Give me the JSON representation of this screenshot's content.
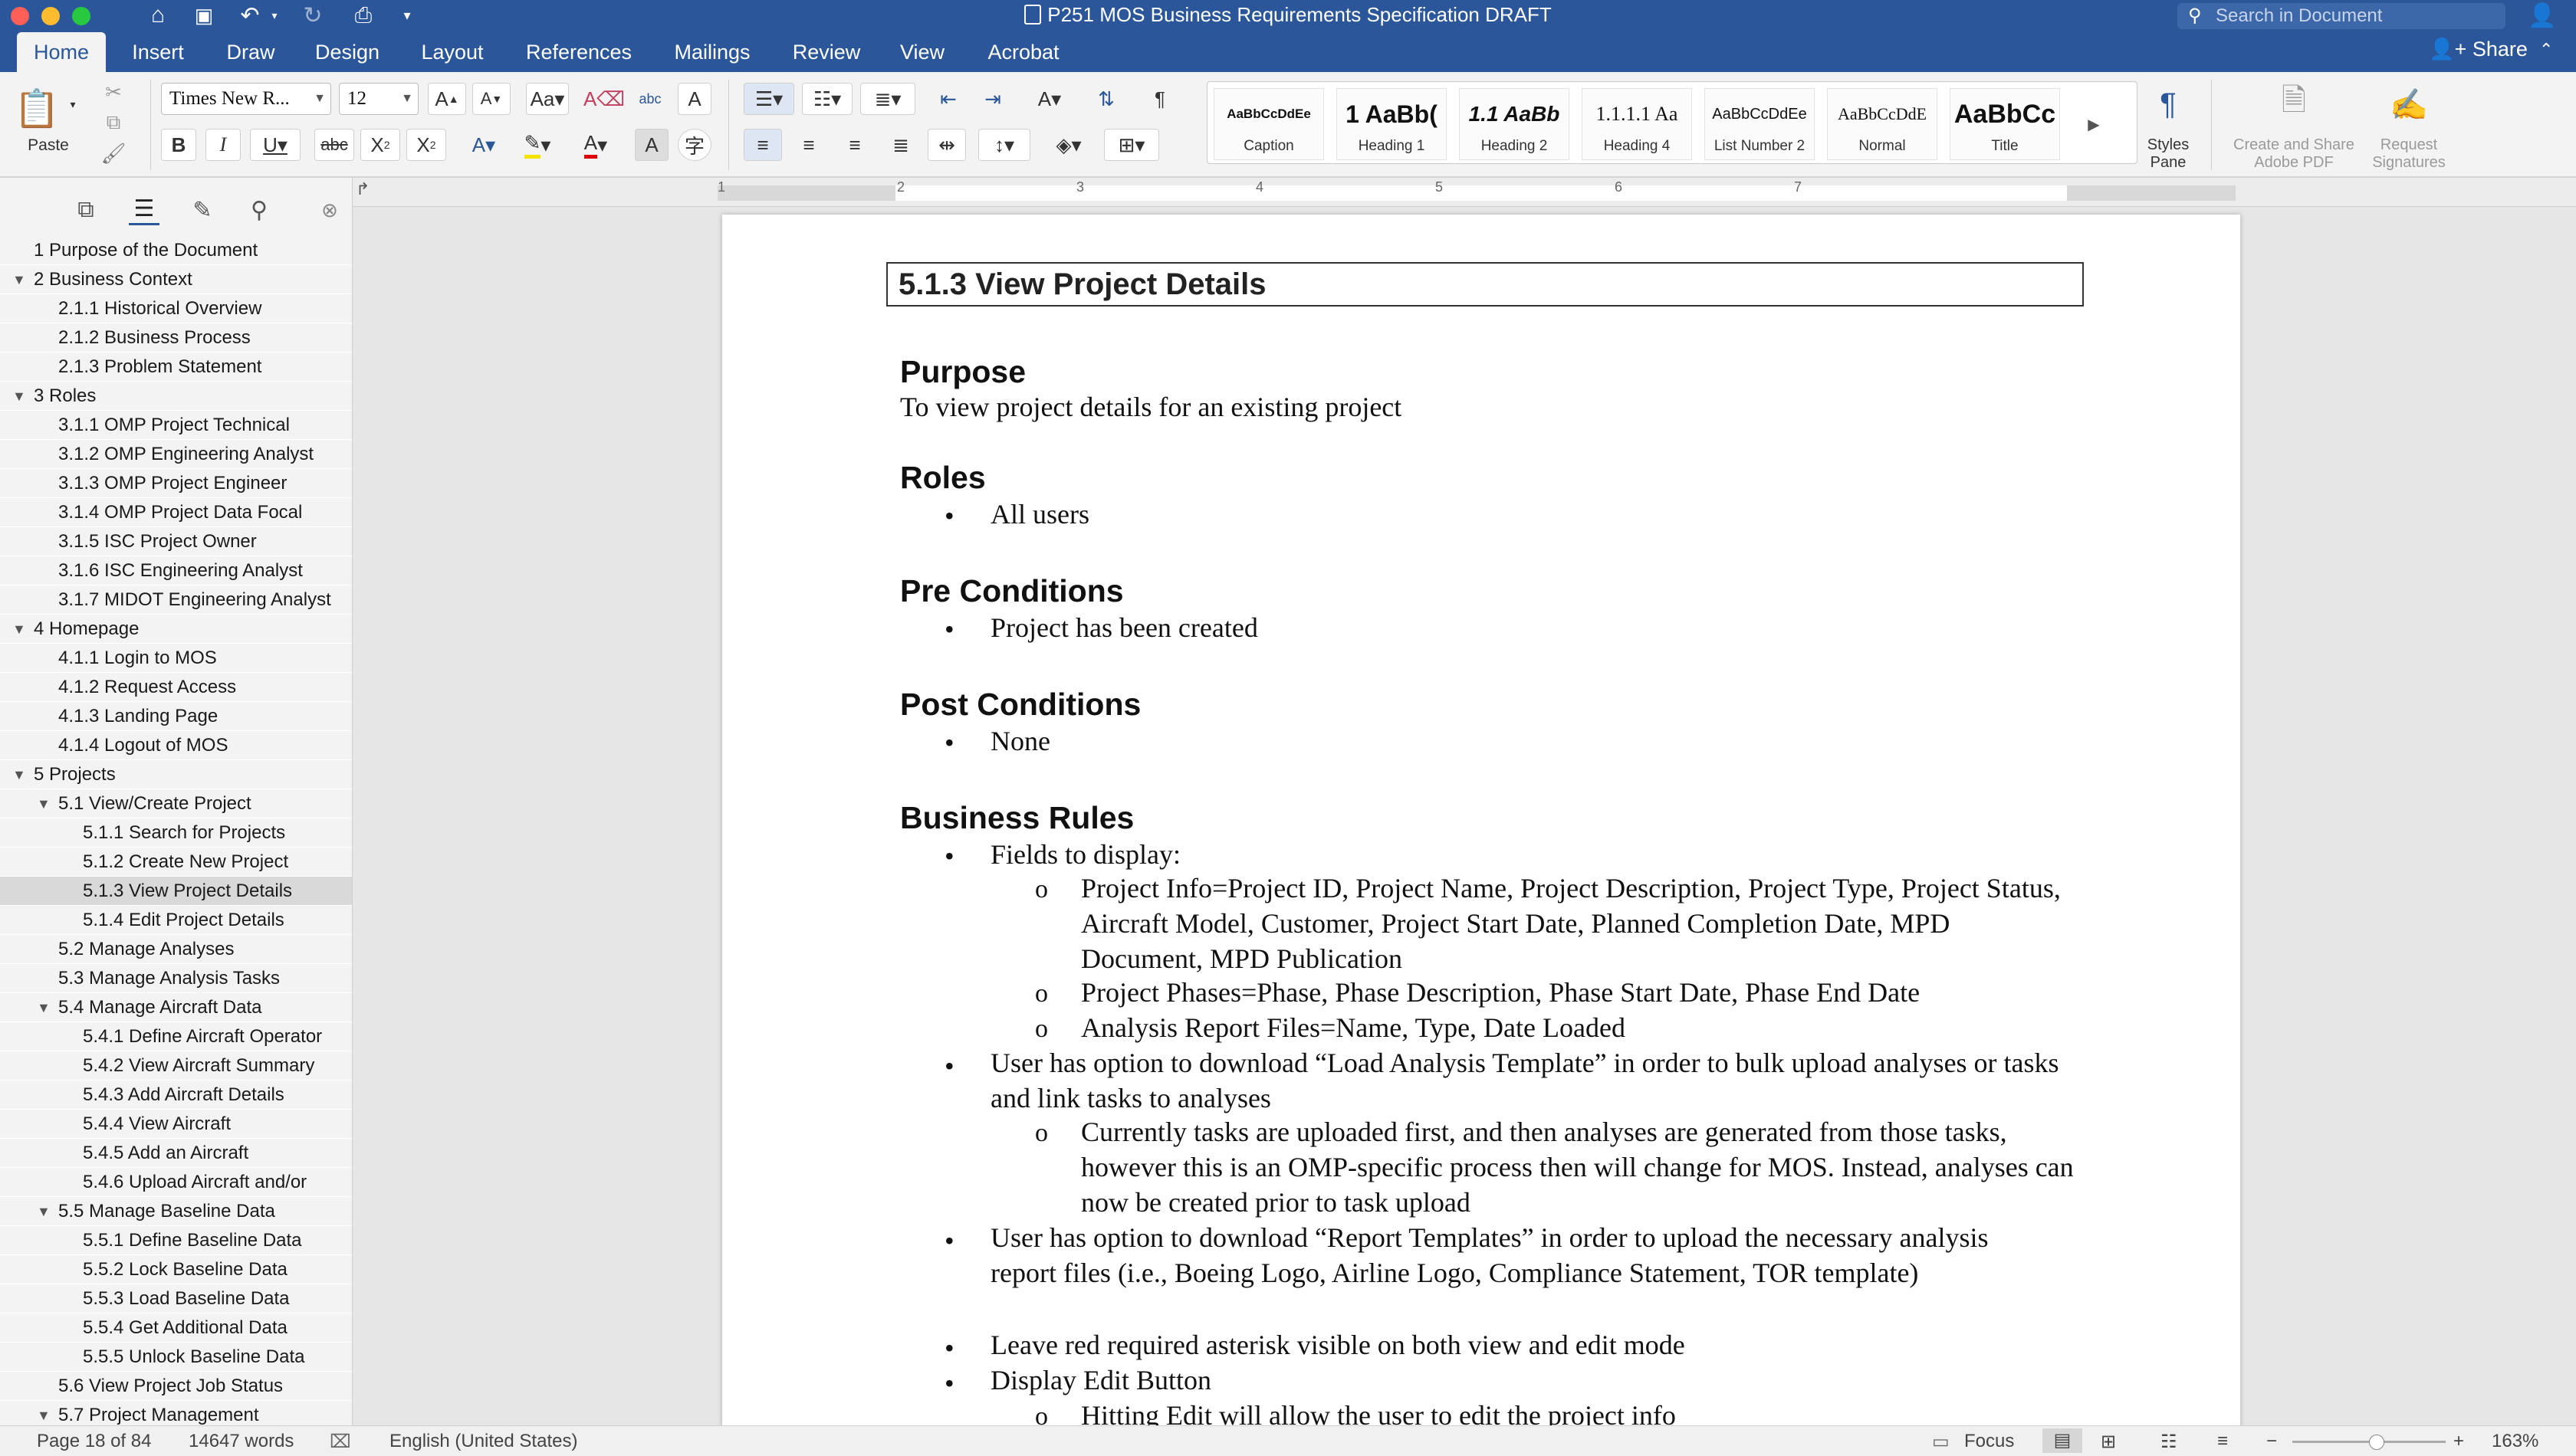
{
  "window": {
    "title": "P251 MOS Business Requirements Specification DRAFT",
    "search_placeholder": "Search in Document",
    "share_label": "Share"
  },
  "tabs": [
    {
      "label": "Home",
      "active": true
    },
    {
      "label": "Insert"
    },
    {
      "label": "Draw"
    },
    {
      "label": "Design"
    },
    {
      "label": "Layout"
    },
    {
      "label": "References"
    },
    {
      "label": "Mailings"
    },
    {
      "label": "Review"
    },
    {
      "label": "View"
    },
    {
      "label": "Acrobat"
    }
  ],
  "ribbon": {
    "paste_label": "Paste",
    "font_name": "Times New R...",
    "font_size": "12",
    "styles": [
      {
        "preview": "AaBbCcDdEe",
        "name": "Caption"
      },
      {
        "preview": "1 AaBb(",
        "name": "Heading 1"
      },
      {
        "preview": "1.1 AaBb",
        "name": "Heading 2"
      },
      {
        "preview": "1.1.1.1 Aa",
        "name": "Heading 4"
      },
      {
        "preview": "AaBbCcDdEe",
        "name": "List Number 2"
      },
      {
        "preview": "AaBbCcDdE",
        "name": "Normal"
      },
      {
        "preview": "AaBbCc",
        "name": "Title"
      }
    ],
    "styles_pane_label_1": "Styles",
    "styles_pane_label_2": "Pane",
    "create_share_1": "Create and Share",
    "create_share_2": "Adobe PDF",
    "request_sig_1": "Request",
    "request_sig_2": "Signatures"
  },
  "navigation": {
    "items": [
      {
        "label": "1 Purpose of the Document",
        "level": 1
      },
      {
        "label": "2 Business Context",
        "level": 1,
        "expanded": true
      },
      {
        "label": "2.1.1 Historical Overview",
        "level": 2
      },
      {
        "label": "2.1.2 Business Process",
        "level": 2
      },
      {
        "label": "2.1.3 Problem Statement",
        "level": 2
      },
      {
        "label": "3 Roles",
        "level": 1,
        "expanded": true
      },
      {
        "label": "3.1.1 OMP Project Technical",
        "level": 2
      },
      {
        "label": "3.1.2 OMP Engineering Analyst",
        "level": 2
      },
      {
        "label": "3.1.3 OMP Project Engineer",
        "level": 2
      },
      {
        "label": "3.1.4 OMP Project Data Focal",
        "level": 2
      },
      {
        "label": "3.1.5 ISC Project Owner",
        "level": 2
      },
      {
        "label": "3.1.6 ISC Engineering Analyst",
        "level": 2
      },
      {
        "label": "3.1.7 MIDOT Engineering Analyst",
        "level": 2
      },
      {
        "label": "4 Homepage",
        "level": 1,
        "expanded": true
      },
      {
        "label": "4.1.1 Login to MOS",
        "level": 2
      },
      {
        "label": "4.1.2 Request Access",
        "level": 2
      },
      {
        "label": "4.1.3 Landing Page",
        "level": 2
      },
      {
        "label": "4.1.4 Logout of MOS",
        "level": 2
      },
      {
        "label": "5 Projects",
        "level": 1,
        "expanded": true
      },
      {
        "label": "5.1 View/Create Project",
        "level": 2,
        "expanded": true
      },
      {
        "label": "5.1.1 Search for Projects",
        "level": 3
      },
      {
        "label": "5.1.2 Create New Project",
        "level": 3
      },
      {
        "label": "5.1.3 View Project Details",
        "level": 3,
        "selected": true
      },
      {
        "label": "5.1.4 Edit Project Details",
        "level": 3
      },
      {
        "label": "5.2 Manage Analyses",
        "level": 2
      },
      {
        "label": "5.3 Manage Analysis Tasks",
        "level": 2
      },
      {
        "label": "5.4 Manage Aircraft Data",
        "level": 2,
        "expanded": true
      },
      {
        "label": "5.4.1 Define Aircraft Operator",
        "level": 3
      },
      {
        "label": "5.4.2 View Aircraft Summary",
        "level": 3
      },
      {
        "label": "5.4.3 Add Aircraft Details",
        "level": 3
      },
      {
        "label": "5.4.4 View Aircraft",
        "level": 3
      },
      {
        "label": "5.4.5 Add an Aircraft",
        "level": 3
      },
      {
        "label": "5.4.6 Upload Aircraft and/or",
        "level": 3
      },
      {
        "label": "5.5 Manage Baseline Data",
        "level": 2,
        "expanded": true
      },
      {
        "label": "5.5.1 Define Baseline Data",
        "level": 3
      },
      {
        "label": "5.5.2 Lock Baseline Data",
        "level": 3
      },
      {
        "label": "5.5.3 Load Baseline Data",
        "level": 3
      },
      {
        "label": "5.5.4 Get Additional Data",
        "level": 3
      },
      {
        "label": "5.5.5 Unlock Baseline Data",
        "level": 3
      },
      {
        "label": "5.6 View Project Job Status",
        "level": 2
      },
      {
        "label": "5.7 Project Management",
        "level": 2,
        "expanded": true
      }
    ]
  },
  "ruler": {
    "numbers": [
      "1",
      "2",
      "3",
      "4",
      "5",
      "6",
      "7"
    ]
  },
  "document": {
    "heading": "5.1.3  View Project Details",
    "purpose_title": "Purpose",
    "purpose_text": "To view project details for an existing project",
    "roles_title": "Roles",
    "roles_items": [
      "All users"
    ],
    "pre_title": "Pre Conditions",
    "pre_items": [
      "Project has been created"
    ],
    "post_title": "Post Conditions",
    "post_items": [
      "None"
    ],
    "rules_title": "Business Rules",
    "rule_1": "Fields to display:",
    "rule_1_sub_1": "Project Info=Project ID, Project Name, Project Description, Project Type, Project Status, Aircraft Model, Customer, Project Start Date, Planned Completion Date, MPD Document, MPD Publication",
    "rule_1_sub_2": "Project Phases=Phase, Phase Description, Phase Start Date, Phase End Date",
    "rule_1_sub_3": "Analysis Report Files=Name, Type, Date Loaded",
    "rule_2": "User has option to download “Load Analysis Template” in order to bulk upload analyses or tasks and link tasks to analyses",
    "rule_2_sub_1": "Currently tasks are uploaded first, and then analyses are generated from those tasks, however this is an OMP-specific process then will change for MOS. Instead, analyses can now be created prior to task upload",
    "rule_3": "User has option to download “Report Templates” in order to upload the necessary analysis report files (i.e., Boeing Logo, Airline Logo, Compliance Statement, TOR template)",
    "rule_4": "Leave red required asterisk visible on both view and edit mode",
    "rule_5": "Display Edit Button",
    "rule_5_sub_1": "Hitting Edit will allow the user to edit the project info"
  },
  "status": {
    "page": "Page 18 of 84",
    "words": "14647 words",
    "language": "English (United States)",
    "focus": "Focus",
    "zoom": "163%"
  },
  "colors": {
    "title_bar": "#2b579a",
    "ribbon": "#f3f3f3",
    "accent": "#2b579a"
  }
}
